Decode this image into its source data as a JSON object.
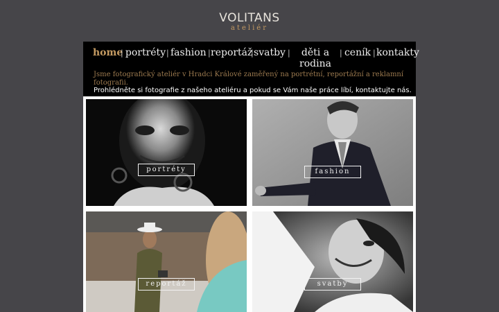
{
  "logo": {
    "name": "VOLITANS",
    "sub": "ateliér"
  },
  "nav": [
    {
      "label": "home",
      "active": true
    },
    {
      "label": "portréty",
      "active": false
    },
    {
      "label": "fashion",
      "active": false
    },
    {
      "label": "reportáž",
      "active": false
    },
    {
      "label": "svatby",
      "active": false
    },
    {
      "label": "děti a rodina",
      "active": false
    },
    {
      "label": "ceník",
      "active": false
    },
    {
      "label": "kontakty",
      "active": false
    }
  ],
  "intro": {
    "line1": "Jsme fotografický ateliér v Hradci Králové zaměřený na portrétní, reportážní a reklamní fotografii.",
    "line2": "Prohlédněte si fotografie z našeho ateliéru a pokud se Vám naše práce líbí, kontaktujte nás."
  },
  "tiles": [
    {
      "label": "portréty"
    },
    {
      "label": "fashion"
    },
    {
      "label": "reportáž"
    },
    {
      "label": "svatby"
    }
  ]
}
